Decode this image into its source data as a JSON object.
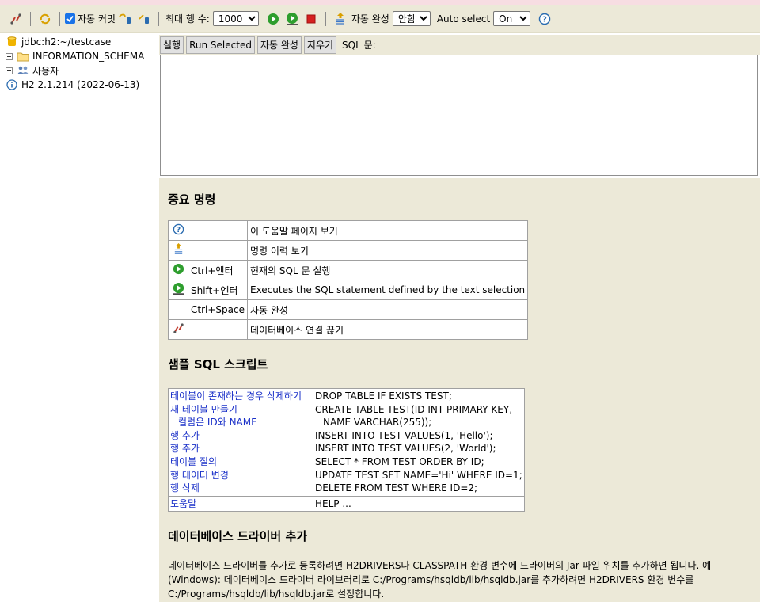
{
  "toolbar": {
    "autocommit_label": "자동 커밋",
    "max_rows_label": "최대 행 수:",
    "max_rows_value": "1000",
    "autocomplete_label": "자동 완성",
    "autocomplete_value": "안함",
    "autoselect_label": "Auto select",
    "autoselect_value": "On"
  },
  "tree": {
    "connection": "jdbc:h2:~/testcase",
    "schema": "INFORMATION_SCHEMA",
    "users": "사용자",
    "version": "H2 2.1.214 (2022-06-13)"
  },
  "sqlbar": {
    "run": "실행",
    "run_selected": "Run Selected",
    "autocomplete": "자동 완성",
    "clear": "지우기",
    "sql_label": "SQL 문:"
  },
  "help": {
    "important_title": "중요 명령",
    "commands": [
      {
        "icon": "help-icon",
        "key": "",
        "desc": "이 도움말 페이지 보기"
      },
      {
        "icon": "history-icon",
        "key": "",
        "desc": "명령 이력 보기"
      },
      {
        "icon": "run-icon",
        "key": "Ctrl+엔터",
        "desc": "현재의 SQL 문 실행"
      },
      {
        "icon": "run-selected-icon",
        "key": "Shift+엔터",
        "desc": "Executes the SQL statement defined by the text selection"
      },
      {
        "icon": "",
        "key": "Ctrl+Space",
        "desc": "자동 완성"
      },
      {
        "icon": "disconnect-icon",
        "key": "",
        "desc": "데이터베이스 연결 끊기"
      }
    ],
    "sample_title": "샘플 SQL 스크립트",
    "samples": {
      "left": [
        "테이블이 존재하는 경우 삭제하기",
        "새 테이블 만들기",
        "컬럼은 ID와 NAME",
        "행 추가",
        "행 추가",
        "테이블 질의",
        "행 데이터 변경",
        "행 삭제"
      ],
      "right": [
        "DROP TABLE IF EXISTS TEST;",
        "CREATE TABLE TEST(ID INT PRIMARY KEY,",
        "NAME VARCHAR(255));",
        "INSERT INTO TEST VALUES(1, 'Hello');",
        "INSERT INTO TEST VALUES(2, 'World');",
        "SELECT * FROM TEST ORDER BY ID;",
        "UPDATE TEST SET NAME='Hi' WHERE ID=1;",
        "DELETE FROM TEST WHERE ID=2;"
      ],
      "help_left": "도움말",
      "help_right": "HELP ..."
    },
    "driver_title": "데이터베이스 드라이버 추가",
    "driver_text": "데이터베이스 드라이버를 추가로 등록하려면 H2DRIVERS나 CLASSPATH 환경 변수에 드라이버의 Jar 파일 위치를 추가하면 됩니다. 예 (Windows): 데이터베이스 드라이버 라이브러리로 C:/Programs/hsqldb/lib/hsqldb.jar를 추가하려면 H2DRIVERS 환경 변수를 C:/Programs/hsqldb/lib/hsqldb.jar로 설정합니다."
  },
  "colors": {
    "panel_bg": "#ece9d8",
    "link": "#1a30c8",
    "run_green": "#2e9e2e",
    "stop_red": "#d62020"
  }
}
